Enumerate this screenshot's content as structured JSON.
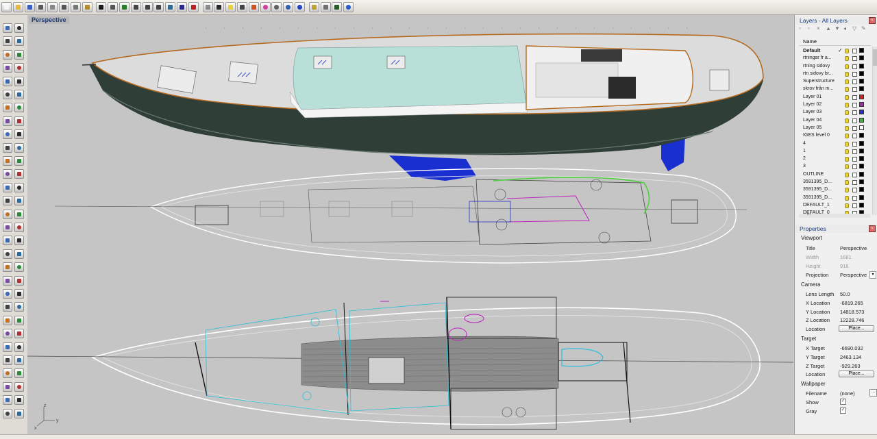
{
  "viewport": {
    "title": "Perspective"
  },
  "layers": {
    "title": "Layers - All Layers",
    "column_name": "Name",
    "current_check": "✓",
    "hscroll_label": "III",
    "items": [
      {
        "name": "Default",
        "color": "#000000",
        "current": true
      },
      {
        "name": "rtningar fr a...",
        "color": "#000000"
      },
      {
        "name": "rtning sidovy",
        "color": "#000000"
      },
      {
        "name": "rtn sidovy br...",
        "color": "#000000"
      },
      {
        "name": "Superstructure",
        "color": "#000000"
      },
      {
        "name": "skrov från m...",
        "color": "#000000"
      },
      {
        "name": "Layer 01",
        "color": "#d32020"
      },
      {
        "name": "Layer 02",
        "color": "#a032a0"
      },
      {
        "name": "Layer 03",
        "color": "#2030c8"
      },
      {
        "name": "Layer 04",
        "color": "#40b040"
      },
      {
        "name": "Layer 05",
        "color": "#ffffff"
      },
      {
        "name": "IGES level 0",
        "color": "#000000"
      },
      {
        "name": "4",
        "color": "#000000"
      },
      {
        "name": "1",
        "color": "#000000"
      },
      {
        "name": "2",
        "color": "#000000"
      },
      {
        "name": "3",
        "color": "#000000"
      },
      {
        "name": "OUTLINE",
        "color": "#000000"
      },
      {
        "name": "3591395_D...",
        "color": "#000000"
      },
      {
        "name": "3591395_D...",
        "color": "#000000"
      },
      {
        "name": "3591395_D...",
        "color": "#000000"
      },
      {
        "name": "DEFAULT_1",
        "color": "#000000"
      },
      {
        "name": "DEFAULT_0",
        "color": "#000000"
      }
    ]
  },
  "properties": {
    "title": "Properties",
    "viewport_section": "Viewport",
    "title_label": "Title",
    "title_value": "Perspective",
    "width_label": "Width",
    "width_value": "1681",
    "height_label": "Height",
    "height_value": "918",
    "projection_label": "Projection",
    "projection_value": "Perspective",
    "camera_section": "Camera",
    "lens_label": "Lens Length",
    "lens_value": "50.0",
    "xloc_label": "X Location",
    "xloc_value": "-6819.265",
    "yloc_label": "Y Location",
    "yloc_value": "14818.573",
    "zloc_label": "Z Location",
    "zloc_value": "12228.746",
    "location_label": "Location",
    "place_button": "Place...",
    "target_section": "Target",
    "xtgt_label": "X Target",
    "xtgt_value": "-6690.032",
    "ytgt_label": "Y Target",
    "ytgt_value": "2463.134",
    "ztgt_label": "Z Target",
    "ztgt_value": "-929.263",
    "tlocation_label": "Location",
    "tplace_button": "Place...",
    "wallpaper_section": "Wallpaper",
    "filename_label": "Filename",
    "filename_value": "(none)",
    "show_label": "Show",
    "gray_label": "Gray",
    "check_mark": "✓",
    "dropdown_glyph": "▾",
    "ellipsis": "..."
  },
  "toolbar_icons": [
    "new-icon",
    "open-icon",
    "save-icon",
    "print-icon",
    "import-icon",
    "cut-icon",
    "copy-icon",
    "paste-icon",
    "undo-icon",
    "pan-icon",
    "rotate-icon",
    "zoom-window-icon",
    "zoom-extents-icon",
    "zoom-selected-icon",
    "undo-view-icon",
    "four-viewports-icon",
    "car-icon",
    "shade-icon",
    "render-icon",
    "bulb-icon",
    "lock-icon",
    "material-icon",
    "color-wheel-icon",
    "circle-icon",
    "globe-icon",
    "sphere-icon",
    "spark-icon",
    "gear-icon",
    "grid-icon",
    "help-icon"
  ],
  "axis_labels": {
    "x": "x",
    "y": "y",
    "z": "z"
  },
  "colors": {
    "hull_dark": "#2a3a34",
    "deck": "#e2e2e2",
    "cabin": "#b8e0d8",
    "keel": "#1a2fd0",
    "teal_lines": "#2ac0d8",
    "magenta_lines": "#c020c0",
    "green_lines": "#50d040",
    "accent": "#1a3f7a"
  }
}
